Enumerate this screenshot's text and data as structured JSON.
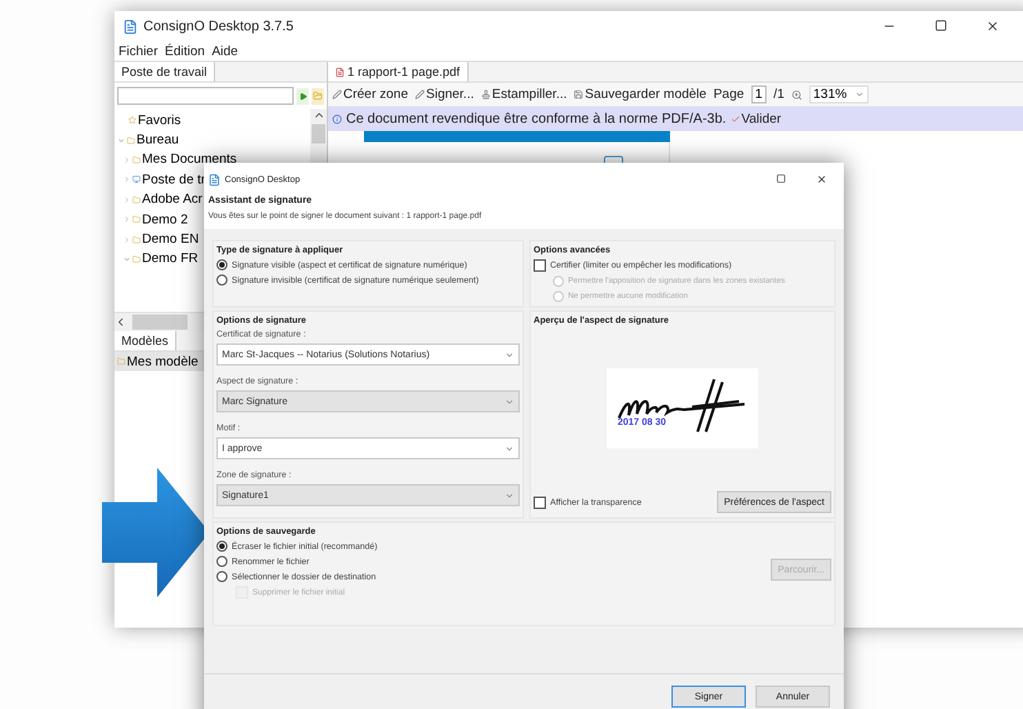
{
  "window": {
    "title": "ConsignO Desktop 3.7.5"
  },
  "menu": [
    "Fichier",
    "Édition",
    "Aide"
  ],
  "workspace": {
    "tab": "Poste de travail",
    "tree": [
      {
        "label": "Favoris",
        "kind": "favorite"
      },
      {
        "label": "Bureau",
        "kind": "folder",
        "expanded": true,
        "children": [
          {
            "label": "Mes Documents",
            "kind": "folder",
            "expanded": false
          },
          {
            "label": "Poste de tr",
            "kind": "computer",
            "expanded": false
          },
          {
            "label": "Adobe Acr",
            "kind": "folder",
            "expanded": false
          },
          {
            "label": "Demo 2",
            "kind": "folder",
            "expanded": false
          },
          {
            "label": "Demo EN",
            "kind": "folder",
            "expanded": false
          },
          {
            "label": "Demo FR",
            "kind": "folder",
            "expanded": true
          }
        ]
      }
    ]
  },
  "models": {
    "tab": "Modèles",
    "items": [
      {
        "label": "Mes modèle",
        "selected": true
      }
    ]
  },
  "editor": {
    "tab": "1 rapport-1 page.pdf",
    "toolbar": [
      "Créer zone",
      "Signer...",
      "Estampiller...",
      "Sauvegarder modèle"
    ],
    "page_label": "Page",
    "page": "1",
    "page_total": "/1",
    "zoom": "131%",
    "notice": "Ce document revendique être conforme à la norme PDF/A-3b.",
    "validate": "Valider"
  },
  "dialog": {
    "title": "ConsignO Desktop",
    "heading": "Assistant de signature",
    "subtitle": "Vous êtes sur le point de signer le document suivant : 1 rapport-1 page.pdf",
    "type_group": {
      "title": "Type de signature à appliquer",
      "options": [
        {
          "label": "Signature visible (aspect et certificat de signature numérique)",
          "selected": true
        },
        {
          "label": "Signature invisible (certificat de signature numérique seulement)",
          "selected": false
        }
      ]
    },
    "advanced": {
      "title": "Options avancées",
      "certify": {
        "label": "Certifier (limiter ou empêcher les modifications)",
        "checked": false
      },
      "options": [
        {
          "label": "Permettre l'apposition de signature dans les zones existantes",
          "selected": false,
          "disabled": true
        },
        {
          "label": "Ne permettre aucune modification",
          "selected": false,
          "disabled": true
        }
      ]
    },
    "signature_options": {
      "title": "Options de signature",
      "fields": [
        {
          "label": "Certificat de signature :",
          "value": "Marc St-Jacques -- Notarius (Solutions Notarius)",
          "disabled": false
        },
        {
          "label": "Aspect de signature :",
          "value": "Marc Signature",
          "disabled": true
        },
        {
          "label": "Motif :",
          "value": "I approve",
          "disabled": false
        },
        {
          "label": "Zone de signature :",
          "value": "Signature1",
          "disabled": true
        }
      ]
    },
    "preview": {
      "title": "Aperçu de l'aspect de signature",
      "date": "2017 08 30",
      "transparency": {
        "label": "Afficher la transparence",
        "checked": false
      },
      "button": "Préférences de l'aspect"
    },
    "save": {
      "title": "Options de sauvegarde",
      "options": [
        {
          "label": "Écraser le fichier initial (recommandé)",
          "selected": true
        },
        {
          "label": "Renommer le fichier",
          "selected": false
        },
        {
          "label": "Sélectionner le dossier de destination",
          "selected": false
        }
      ],
      "delete_original": {
        "label": "Supprimer le fichier initial",
        "checked": false,
        "disabled": true
      },
      "browse": {
        "label": "Parcourir...",
        "disabled": true
      }
    },
    "buttons": [
      "Signer",
      "Annuler"
    ]
  }
}
